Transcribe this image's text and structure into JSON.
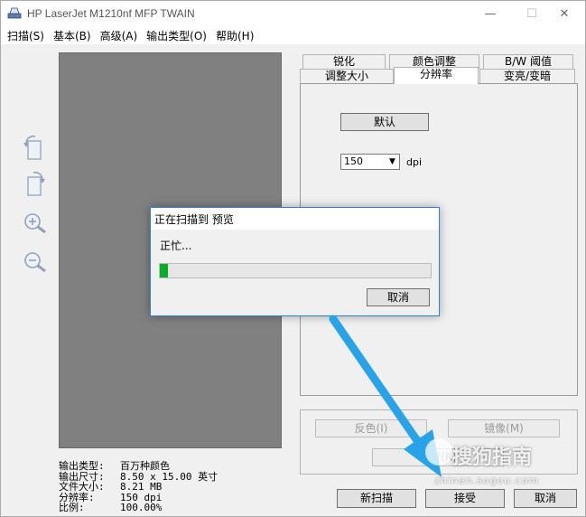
{
  "window": {
    "title": "HP LaserJet M1210nf MFP TWAIN",
    "controls": {
      "minimize": "—",
      "maximize": "☐",
      "close": "✕"
    }
  },
  "menu": [
    {
      "label": "扫描(S)"
    },
    {
      "label": "基本(B)"
    },
    {
      "label": "高级(A)"
    },
    {
      "label": "输出类型(O)"
    },
    {
      "label": "帮助(H)"
    }
  ],
  "tools": [
    {
      "name": "rotate-left-icon"
    },
    {
      "name": "rotate-right-icon"
    },
    {
      "name": "zoom-in-icon"
    },
    {
      "name": "zoom-out-icon"
    }
  ],
  "info": [
    {
      "key": "输出类型:",
      "value": "百万种颜色"
    },
    {
      "key": "输出尺寸:",
      "value": "8.50 x 15.00 英寸"
    },
    {
      "key": "文件大小:",
      "value": "8.21 MB"
    },
    {
      "key": "分辨率:",
      "value": "150 dpi"
    },
    {
      "key": "比例:",
      "value": "100.00%"
    }
  ],
  "tabs": {
    "row_back": [
      {
        "label": "锐化"
      },
      {
        "label": "颜色调整"
      },
      {
        "label": "B/W 阈值"
      }
    ],
    "row_front": [
      {
        "label": "调整大小"
      },
      {
        "label": "分辨率",
        "active": true
      },
      {
        "label": "变亮/变暗"
      }
    ]
  },
  "resolution_panel": {
    "default_button": "默认",
    "dpi_value": "150",
    "dpi_unit": "dpi"
  },
  "actions": {
    "invert": "反色(I)",
    "mirror": "镜像(M)",
    "reset": "重置(R)",
    "new_scan": "新扫描",
    "accept": "接受",
    "cancel": "取消"
  },
  "dialog": {
    "title": "正在扫描到 预览",
    "message": "正忙...",
    "progress_percent": 3,
    "cancel": "取消"
  },
  "watermark": {
    "text": "搜狗指南",
    "url": "zhinan.sogou.com"
  },
  "colors": {
    "accent": "#2a82da",
    "progress": "#06b025",
    "annotation_arrow": "#29a3e8"
  }
}
